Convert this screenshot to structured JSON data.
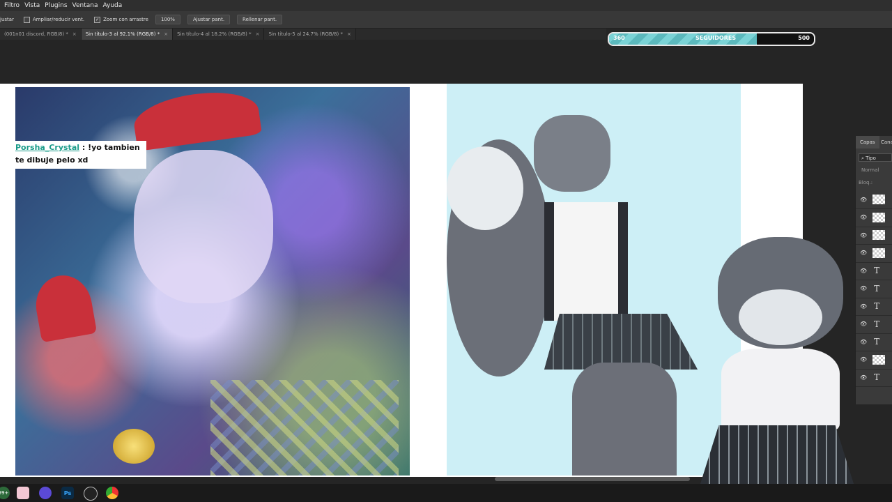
{
  "menu": [
    "Filtro",
    "Vista",
    "Plugins",
    "Ventana",
    "Ayuda"
  ],
  "options": {
    "adjust_label": "justar",
    "resize_label": "Ampliar/reducir vent.",
    "zoom_drag_label": "Zoom con arrastre",
    "zoom_drag_checked_mark": "✓",
    "zoom_value": "100%",
    "fit_button": "Ajustar pant.",
    "fill_button": "Rellenar pant."
  },
  "tabs": [
    {
      "label": "(001n01 discord, RGB/8) *"
    },
    {
      "label": "Sin título-3 al 92.1% (RGB/8) *"
    },
    {
      "label": "Sin título-4 al 18.2% (RGB/8) *"
    },
    {
      "label": "Sin título-5 al 24.7% (RGB/8) *"
    }
  ],
  "tab_close": "×",
  "followers": {
    "current": "360",
    "label": "SEGUIDORES",
    "goal": "500",
    "progress_fraction": 0.72
  },
  "chat": {
    "user": "Porsha_Crystal",
    "message": " : !yo tambien te dibuje pelo xd"
  },
  "layers_panel": {
    "tab_layers": "Capas",
    "tab_channels": "Canal",
    "search_placeholder": "Tipo",
    "blend_mode": "Normal",
    "lock_label": "Bloq.:",
    "eye_glyph": "👁",
    "text_glyph": "T",
    "rows": [
      "image",
      "image",
      "image",
      "image",
      "text",
      "text",
      "text",
      "text",
      "text",
      "image",
      "text"
    ]
  },
  "taskbar": {
    "badge": "99+",
    "ps_label": "Ps"
  },
  "colors": {
    "accent": "#5bb9bd",
    "chat_user": "#1b9c8a"
  }
}
